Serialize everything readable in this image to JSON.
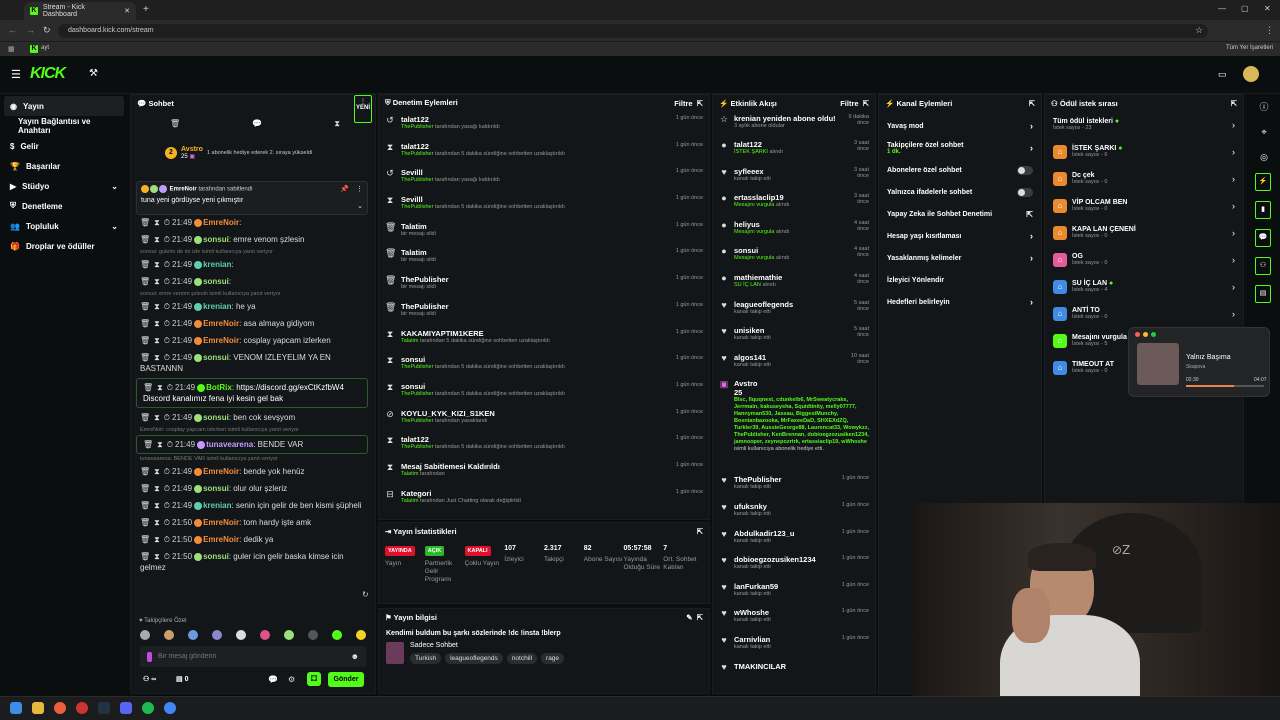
{
  "browser": {
    "tab_title": "Stream - Kick Dashboard",
    "url": "dashboard.kick.com/stream",
    "bookmark_label": "Tüm Yer İşaretleri",
    "bookmark_item": "ayt"
  },
  "header": {
    "logo": "KICK"
  },
  "sidebar": {
    "items": [
      {
        "label": "Yayın",
        "icon": "radio-icon",
        "active": true
      },
      {
        "label": "Yayın Bağlantısı ve Anahtarı",
        "sub": true
      },
      {
        "label": "Gelir",
        "icon": "dollar-icon"
      },
      {
        "label": "Başarılar",
        "icon": "trophy-icon"
      },
      {
        "label": "Stüdyo",
        "icon": "video-icon",
        "expand": true
      },
      {
        "label": "Denetleme",
        "icon": "shield-icon"
      },
      {
        "label": "Topluluk",
        "icon": "users-icon",
        "expand": true
      },
      {
        "label": "Droplar ve ödüller",
        "icon": "gift-icon"
      }
    ]
  },
  "chat": {
    "title": "Sohbet",
    "new_label": "YENİ",
    "gift": {
      "user": "Avstro",
      "count": "25",
      "text": "1 abonelik hediye ederek 2. sıraya yükseldi"
    },
    "pinned": {
      "by": "EmreNoir",
      "by_suffix": "tarafından sabitlendi",
      "text": "tuna yeni gördüyse yeni çıkmıştır"
    },
    "messages": [
      {
        "reply": "",
        "time": "21:49",
        "user": "EmreNoir",
        "color": "#f08c3c",
        "text": ""
      },
      {
        "reply": "",
        "time": "21:49",
        "user": "sonsui",
        "color": "#9be07a",
        "text": "emre venom şzlesin"
      },
      {
        "reply": "sonsui: gulerin de mi izle isimli kullanıcıya yanıt veriyor",
        "time": "21:49",
        "user": "krenian",
        "color": "#5dd0a8",
        "text": ""
      },
      {
        "reply": "",
        "time": "21:49",
        "user": "sonsui",
        "color": "#9be07a",
        "text": ""
      },
      {
        "reply": "sonsui: emre venom şzlesin isimli kullanıcıya yanıt veriyor",
        "time": "21:49",
        "user": "krenian",
        "color": "#5dd0a8",
        "text": "he ya"
      },
      {
        "reply": "",
        "time": "21:49",
        "user": "EmreNoir",
        "color": "#f08c3c",
        "text": "asa almaya gidiyom"
      },
      {
        "reply": "",
        "time": "21:49",
        "user": "EmreNoir",
        "color": "#f08c3c",
        "text": "cosplay yapcam izlerken"
      },
      {
        "reply": "",
        "time": "21:49",
        "user": "sonsui",
        "color": "#9be07a",
        "text": "VENOM IZLEYELIM YA EN BASTANNN"
      },
      {
        "reply": "",
        "time": "21:49",
        "user": "BotRix",
        "color": "#53fc18",
        "text": "https://discord.gg/exCtKzfbW4 Discord kanalımız fena iyi kesin gel bak"
      },
      {
        "reply": "",
        "time": "21:49",
        "user": "sonsui",
        "color": "#9be07a",
        "text": "ben cok sevşyom"
      },
      {
        "reply": "EmreNoir: cosplay yapcam izlerken isimli kullanıcıya yanıt veriyor",
        "time": "21:49",
        "user": "tunavearena",
        "color": "#c39bff",
        "text": "BENDE VAR"
      },
      {
        "reply": "tunavearena: BENDE VAR isimli kullanıcıya yanıt veriyor",
        "time": "21:49",
        "user": "EmreNoir",
        "color": "#f08c3c",
        "text": "bende yok henüz"
      },
      {
        "reply": "",
        "time": "21:49",
        "user": "sonsui",
        "color": "#9be07a",
        "text": "olur olur şzleriz"
      },
      {
        "reply": "",
        "time": "21:49",
        "user": "krenian",
        "color": "#5dd0a8",
        "text": "senin için gelir de ben kismi şüpheli"
      },
      {
        "reply": "",
        "time": "21:50",
        "user": "EmreNoir",
        "color": "#f08c3c",
        "text": "tom hardy işte amk"
      },
      {
        "reply": "",
        "time": "21:50",
        "user": "EmreNoir",
        "color": "#f08c3c",
        "text": "dedik ya"
      },
      {
        "reply": "",
        "time": "21:50",
        "user": "sonsui",
        "color": "#9be07a",
        "text": "guler icin gelir baska kimse icin gelmez"
      }
    ],
    "emote_label": "Takipçilere Özel",
    "placeholder": "Bir mesaj gönderin",
    "points": "∞",
    "counter": "0",
    "send": "Gönder"
  },
  "modlog": {
    "title": "Denetim Eylemleri",
    "filter": "Filtre",
    "items": [
      {
        "icon": "↺",
        "name": "talat122",
        "actor": "ThePublisher",
        "desc": "tarafından yasağı kaldırıldı",
        "time": "1 gün önce"
      },
      {
        "icon": "⧗",
        "name": "talat122",
        "actor": "ThePublisher",
        "desc": "tarafından 5 dakika süreliğine sohbetten uzaklaştırıldı",
        "time": "1 gün önce"
      },
      {
        "icon": "↺",
        "name": "Sevilll",
        "actor": "ThePublisher",
        "desc": "tarafından yasağı kaldırıldı",
        "time": "1 gün önce"
      },
      {
        "icon": "⧗",
        "name": "Sevilll",
        "actor": "ThePublisher",
        "desc": "tarafından 5 dakika süreliğine sohbetten uzaklaştırıldı",
        "time": "1 gün önce"
      },
      {
        "icon": "🗑",
        "name": "Talatim",
        "actor": "",
        "desc": "bir mesajı sildi",
        "time": "1 gün önce"
      },
      {
        "icon": "🗑",
        "name": "Talatim",
        "actor": "",
        "desc": "bir mesajı sildi",
        "time": "1 gün önce"
      },
      {
        "icon": "🗑",
        "name": "ThePublisher",
        "actor": "",
        "desc": "bir mesajı sildi",
        "time": "1 gün önce"
      },
      {
        "icon": "🗑",
        "name": "ThePublisher",
        "actor": "",
        "desc": "bir mesajı sildi",
        "time": "1 gün önce"
      },
      {
        "icon": "⧗",
        "name": "KAKAMIYAPTIM1KERE",
        "actor": "Talatim",
        "desc": "tarafından 5 dakika süreliğine sohbetten uzaklaştırıldı",
        "time": "1 gün önce"
      },
      {
        "icon": "⧗",
        "name": "sonsui",
        "actor": "ThePublisher",
        "desc": "tarafından 5 dakika süreliğine sohbetten uzaklaştırıldı",
        "time": "1 gün önce"
      },
      {
        "icon": "⧗",
        "name": "sonsui",
        "actor": "ThePublisher",
        "desc": "tarafından 5 dakika süreliğine sohbetten uzaklaştırıldı",
        "time": "1 gün önce"
      },
      {
        "icon": "⊘",
        "name": "KOYLU_KYK_KIZI_S1KEN",
        "actor": "ThePublisher",
        "desc": "tarafından yasaklandı",
        "time": "1 gün önce"
      },
      {
        "icon": "⧗",
        "name": "talat122",
        "actor": "ThePublisher",
        "desc": "tarafından 5 dakika süreliğine sohbetten uzaklaştırıldı",
        "time": "1 gün önce"
      },
      {
        "icon": "⧗",
        "name": "Mesaj Sabitlemesi Kaldırıldı",
        "actor": "Talatim",
        "desc": "tarafından",
        "time": "1 gün önce"
      },
      {
        "icon": "⊟",
        "name": "Kategori",
        "actor": "Talatim",
        "desc": "tarafından Just Chatting olarak değiştirildi",
        "time": "1 gün önce"
      }
    ]
  },
  "stats": {
    "title": "Yayın İstatistikleri",
    "items": [
      {
        "value": "YAYINDA",
        "label": "Yayın",
        "pill": "#e0102a"
      },
      {
        "value": "AÇIK",
        "label": "Partnerlik Gelir Programı",
        "pill": "#2db82a"
      },
      {
        "value": "KAPALI",
        "label": "Çoklu Yayın",
        "pill": "#e0102a"
      },
      {
        "value": "107",
        "label": "İzleyici"
      },
      {
        "value": "2.317",
        "label": "Takipçi"
      },
      {
        "value": "82",
        "label": "Abone Sayısı"
      },
      {
        "value": "05:57:58",
        "label": "Yayında Olduğu Süre"
      },
      {
        "value": "7",
        "label": "Ort. Sohbet Katılan"
      }
    ]
  },
  "info": {
    "title": "Yayın bilgisi",
    "stream_title": "Kendimi buldum bu şarkı sözlerinde !dc !insta !blerp",
    "category": "Sadece Sohbet",
    "tags": [
      "Turkish",
      "leagueoflegends",
      "notchill",
      "rage"
    ]
  },
  "activity": {
    "title": "Etkinlik Akışı",
    "filter": "Filtre",
    "items": [
      {
        "icon": "☆",
        "name": "krenian yeniden abone oldu!",
        "sub": "3 aylık abone oldular",
        "time": "9 dakika önce"
      },
      {
        "icon": "●",
        "name": "talat122",
        "sub": "İSTEK ŞARKI",
        "subsuffix": "alındı",
        "time": "3 saat önce"
      },
      {
        "icon": "♥",
        "name": "syfleeex",
        "sub": "kanalı takip etti",
        "time": "3 saat önce"
      },
      {
        "icon": "●",
        "name": "ertasslaclip19",
        "sub": "Mesajını vurgula",
        "subsuffix": "alındı",
        "time": "3 saat önce"
      },
      {
        "icon": "●",
        "name": "heliyus",
        "sub": "Mesajını vurgula",
        "subsuffix": "alındı",
        "time": "4 saat önce"
      },
      {
        "icon": "●",
        "name": "sonsui",
        "sub": "Mesajını vurgula",
        "subsuffix": "alındı",
        "time": "4 saat önce"
      },
      {
        "icon": "●",
        "name": "mathiemathie",
        "sub": "SU İÇ LAN",
        "subsuffix": "alındı",
        "time": "4 saat önce"
      },
      {
        "icon": "♥",
        "name": "leagueoflegends",
        "sub": "kanalı takip etti",
        "time": "5 saat önce"
      },
      {
        "icon": "♥",
        "name": "unisiken",
        "sub": "kanalı takip etti",
        "time": "5 saat önce"
      },
      {
        "icon": "♥",
        "name": "algos141",
        "sub": "kanalı takip etti",
        "time": "10 saat önce"
      }
    ],
    "gift_block": {
      "name": "Avstro",
      "count": "25",
      "names": "Blsc, Ilquqnext, cdunkelb6, MrSweatycraks, Jerrmain, kakuseysha, Squidtinity, melly07777, Hannyman530, Jassau, BiggestMunchy, Bosnianbazooka, MrFaxeeDaD, SHXEXdZQ, Turkler39, AussieGeorge88, Laurencat33, Wowykzz, ThePublisher, KenBrennan, dobioegzozusiken1234, jamnooper, zeynepozrtrk, ertassiaclip19, wWhoshe",
      "suffix": "isimli kullanıcıya abonelik hediye etti."
    },
    "items2": [
      {
        "icon": "♥",
        "name": "ThePublisher",
        "sub": "kanalı takip etti",
        "time": "1 gün önce"
      },
      {
        "icon": "♥",
        "name": "ufuksnky",
        "sub": "kanalı takip etti",
        "time": "1 gün önce"
      },
      {
        "icon": "♥",
        "name": "Abdulkadir123_u",
        "sub": "kanalı takip etti",
        "time": "1 gün önce"
      },
      {
        "icon": "♥",
        "name": "dobioegzozusiken1234",
        "sub": "kanalı takip etti",
        "time": "1 gün önce"
      },
      {
        "icon": "♥",
        "name": "lanFurkan59",
        "sub": "kanalı takip etti",
        "time": "1 gün önce"
      },
      {
        "icon": "♥",
        "name": "wWhoshe",
        "sub": "kanalı takip etti",
        "time": "1 gün önce"
      },
      {
        "icon": "♥",
        "name": "Carnivlian",
        "sub": "kanalı takip etti",
        "time": "1 gün önce"
      },
      {
        "icon": "♥",
        "name": "TMAKINCILAR",
        "sub": "",
        "time": ""
      }
    ]
  },
  "channel": {
    "title": "Kanal Eylemleri",
    "items": [
      {
        "label": "Yavaş mod",
        "kind": "chev"
      },
      {
        "label": "Takipçilere özel sohbet",
        "sub": "1 dk.",
        "kind": "chev"
      },
      {
        "label": "Abonelere özel sohbet",
        "kind": "toggle"
      },
      {
        "label": "Yalnızca ifadelerle sohbet",
        "kind": "toggle"
      },
      {
        "label": "Yapay Zeka ile Sohbet Denetimi",
        "kind": "ext"
      },
      {
        "label": "Hesap yaşı kısıtlaması",
        "kind": "chev"
      },
      {
        "label": "Yasaklanmış kelimeler",
        "kind": "chev"
      },
      {
        "label": "İzleyici Yönlendir",
        "kind": "none"
      },
      {
        "label": "Hedefleri belirleyin",
        "kind": "chev"
      }
    ]
  },
  "rewards": {
    "title": "Ödül istek sırası",
    "all_label": "Tüm ödül istekleri",
    "all_sub": "İstek sayısı - 23",
    "items": [
      {
        "name": "İSTEK ŞARKI",
        "sub": "İstek sayısı - 6",
        "color": "#e98a2e",
        "dot": true
      },
      {
        "name": "Dc çek",
        "sub": "İstek sayısı - 0",
        "color": "#e98a2e"
      },
      {
        "name": "VİP OLCAM BEN",
        "sub": "İstek sayısı - 0",
        "color": "#e98a2e"
      },
      {
        "name": "KAPA LAN ÇENENİ",
        "sub": "İstek sayısı - 0",
        "color": "#e98a2e"
      },
      {
        "name": "OG",
        "sub": "İstek sayısı - 0",
        "color": "#e85a9c"
      },
      {
        "name": "SU İÇ LAN",
        "sub": "İstek sayısı - 4",
        "color": "#3f8be6",
        "dot": true
      },
      {
        "name": "ANTİ TO",
        "sub": "İstek sayısı - 0",
        "color": "#3f8be6"
      },
      {
        "name": "Mesajını vurgula",
        "sub": "İstek sayısı - 5",
        "color": "#53fc18"
      },
      {
        "name": "TIMEOUT AT",
        "sub": "İstek sayısı - 0",
        "color": "#3f8be6"
      }
    ]
  },
  "player": {
    "title": "Yalnız Başıma",
    "artist": "Skapova",
    "elapsed": "02:30",
    "total": "04:07",
    "progress": 0.61
  },
  "colors": {
    "accent": "#53fc18",
    "bg": "#0b0e0f",
    "panel": "#131618"
  }
}
